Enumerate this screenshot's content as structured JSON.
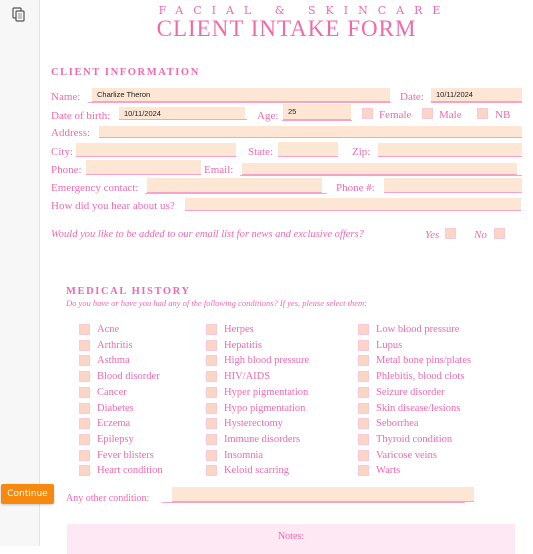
{
  "viewer": {
    "continue_label": "Continue"
  },
  "header": {
    "subtitle": "FACIAL & SKINCARE",
    "title": "CLIENT INTAKE FORM"
  },
  "client_info": {
    "heading": "CLIENT INFORMATION",
    "name_label": "Name:",
    "name_value": "Charlize Theron",
    "date_label": "Date:",
    "date_value": "10/11/2024",
    "dob_label": "Date of birth:",
    "dob_value": "10/11/2024",
    "age_label": "Age:",
    "age_value": "25",
    "gender_options": [
      "Female",
      "Male",
      "NB"
    ],
    "address_label": "Address:",
    "address_value": "",
    "city_label": "City:",
    "city_value": "",
    "state_label": "State:",
    "state_value": "",
    "zip_label": "Zip:",
    "zip_value": "",
    "phone_label": "Phone:",
    "phone_value": "",
    "email_label": "Email:",
    "email_value": "",
    "emergency_label": "Emergency contact:",
    "emergency_value": "",
    "emergency_phone_label": "Phone #:",
    "emergency_phone_value": "",
    "hear_label": "How did you hear about us?",
    "hear_value": ""
  },
  "email_list": {
    "question": "Would you like to be added to our email list for news and exclusive offers?",
    "yes_label": "Yes",
    "no_label": "No"
  },
  "medical_history": {
    "heading": "MEDICAL HISTORY",
    "prompt": "Do you have or have you had any of the following conditions? If yes, please select them:",
    "columns": [
      [
        "Acne",
        "Arthritis",
        "Asthma",
        "Blood disorder",
        "Cancer",
        "Diabetes",
        "Eczema",
        "Epilepsy",
        "Fever blisters",
        "Heart condition"
      ],
      [
        "Herpes",
        "Hepatitis",
        "High blood pressure",
        "HIV/AIDS",
        "Hyper pigmentation",
        "Hypo pigmentation",
        "Hysterectomy",
        "Immune disorders",
        "Insomnia",
        "Keloid scarring"
      ],
      [
        "Low blood pressure",
        "Lupus",
        "Metal bone pins/plates",
        "Phlebitis, blood clots",
        "Seizure disorder",
        "Skin disease/lesions",
        "Seborrhea",
        "Thyroid condition",
        "Varicose veins",
        "Warts"
      ]
    ],
    "other_label": "Any other condition:",
    "other_value": ""
  },
  "notes": {
    "label": "Notes:"
  }
}
